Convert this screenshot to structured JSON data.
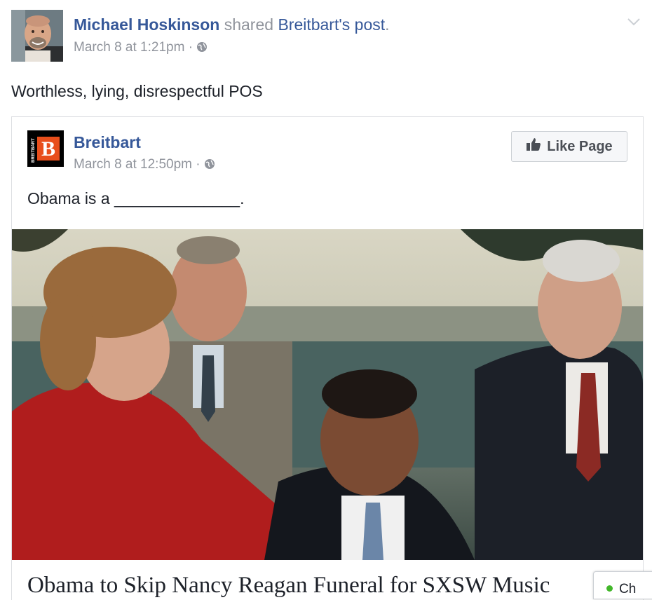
{
  "post": {
    "author": "Michael Hoskinson",
    "shared_text": "shared",
    "source_name": "Breitbart",
    "possessive": "'s",
    "post_link": "post",
    "period": ".",
    "timestamp": "March 8 at 1:21pm",
    "separator": "·",
    "privacy_icon": "globe-icon",
    "menu_icon": "chevron-down-icon",
    "text": "Worthless, lying, disrespectful POS"
  },
  "shared_post": {
    "page_name": "Breitbart",
    "timestamp": "March 8 at 12:50pm",
    "separator": "·",
    "privacy_icon": "globe-icon",
    "like_button": "Like Page",
    "like_icon": "thumbs-up-icon",
    "logo_letter": "B",
    "logo_side_text": "BREITBART",
    "text": "Obama is a ______________.",
    "headline": "Obama to Skip Nancy Reagan Funeral for SXSW Music"
  },
  "chat": {
    "label": "Ch",
    "status_color": "#42b72a"
  },
  "colors": {
    "link": "#365899",
    "muted": "#90949c",
    "text": "#1d2129",
    "logo_red": "#e84e1b"
  }
}
